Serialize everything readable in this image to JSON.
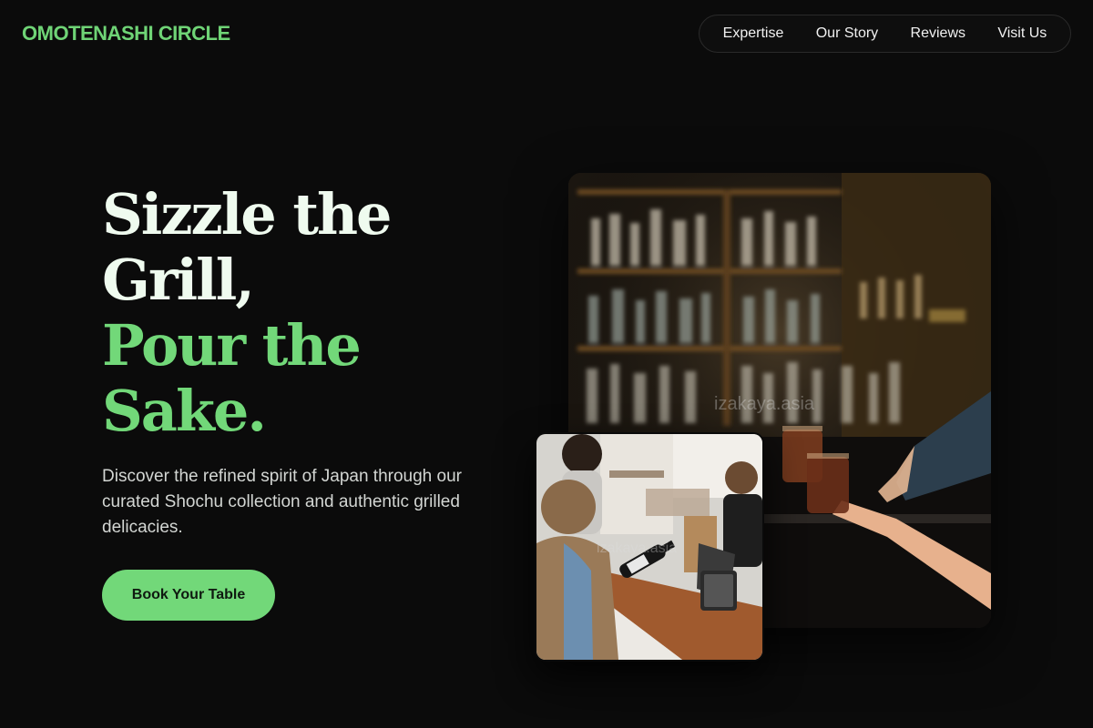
{
  "brand": {
    "name": "OMOTENASHI CIRCLE"
  },
  "nav": {
    "items": [
      {
        "label": "Expertise"
      },
      {
        "label": "Our Story"
      },
      {
        "label": "Reviews"
      },
      {
        "label": "Visit Us"
      }
    ]
  },
  "hero": {
    "headline_line1": "Sizzle the",
    "headline_line2": "Grill,",
    "headline_line3": "Pour the",
    "headline_line4": "Sake.",
    "description": "Discover the refined spirit of Japan through our curated Shochu collection and authentic grilled delicacies.",
    "cta_label": "Book Your Table"
  },
  "images": {
    "main_watermark": "izakaya.asia",
    "small_watermark": "izakaya.asia"
  },
  "colors": {
    "accent": "#72d879",
    "background": "#0b0b0b",
    "headline_light": "#effbef"
  }
}
